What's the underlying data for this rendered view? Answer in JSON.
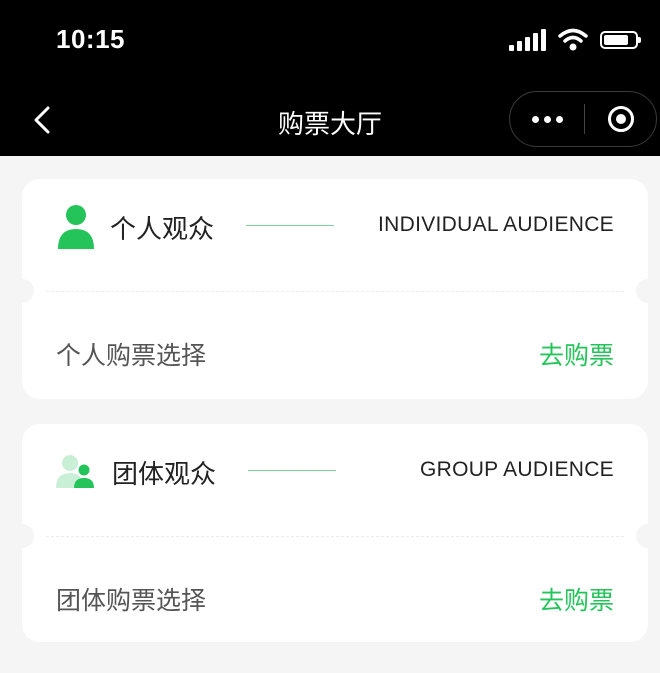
{
  "status_bar": {
    "time": "10:15"
  },
  "nav": {
    "title": "购票大厅"
  },
  "cards": [
    {
      "title": "个人观众",
      "subtitle": "INDIVIDUAL AUDIENCE",
      "option_label": "个人购票选择",
      "action_label": "去购票",
      "icon": "person-icon"
    },
    {
      "title": "团体观众",
      "subtitle": "GROUP AUDIENCE",
      "option_label": "团体购票选择",
      "action_label": "去购票",
      "icon": "group-icon"
    }
  ],
  "colors": {
    "accent": "#25c45a",
    "background": "#f5f5f5",
    "header": "#000000"
  }
}
